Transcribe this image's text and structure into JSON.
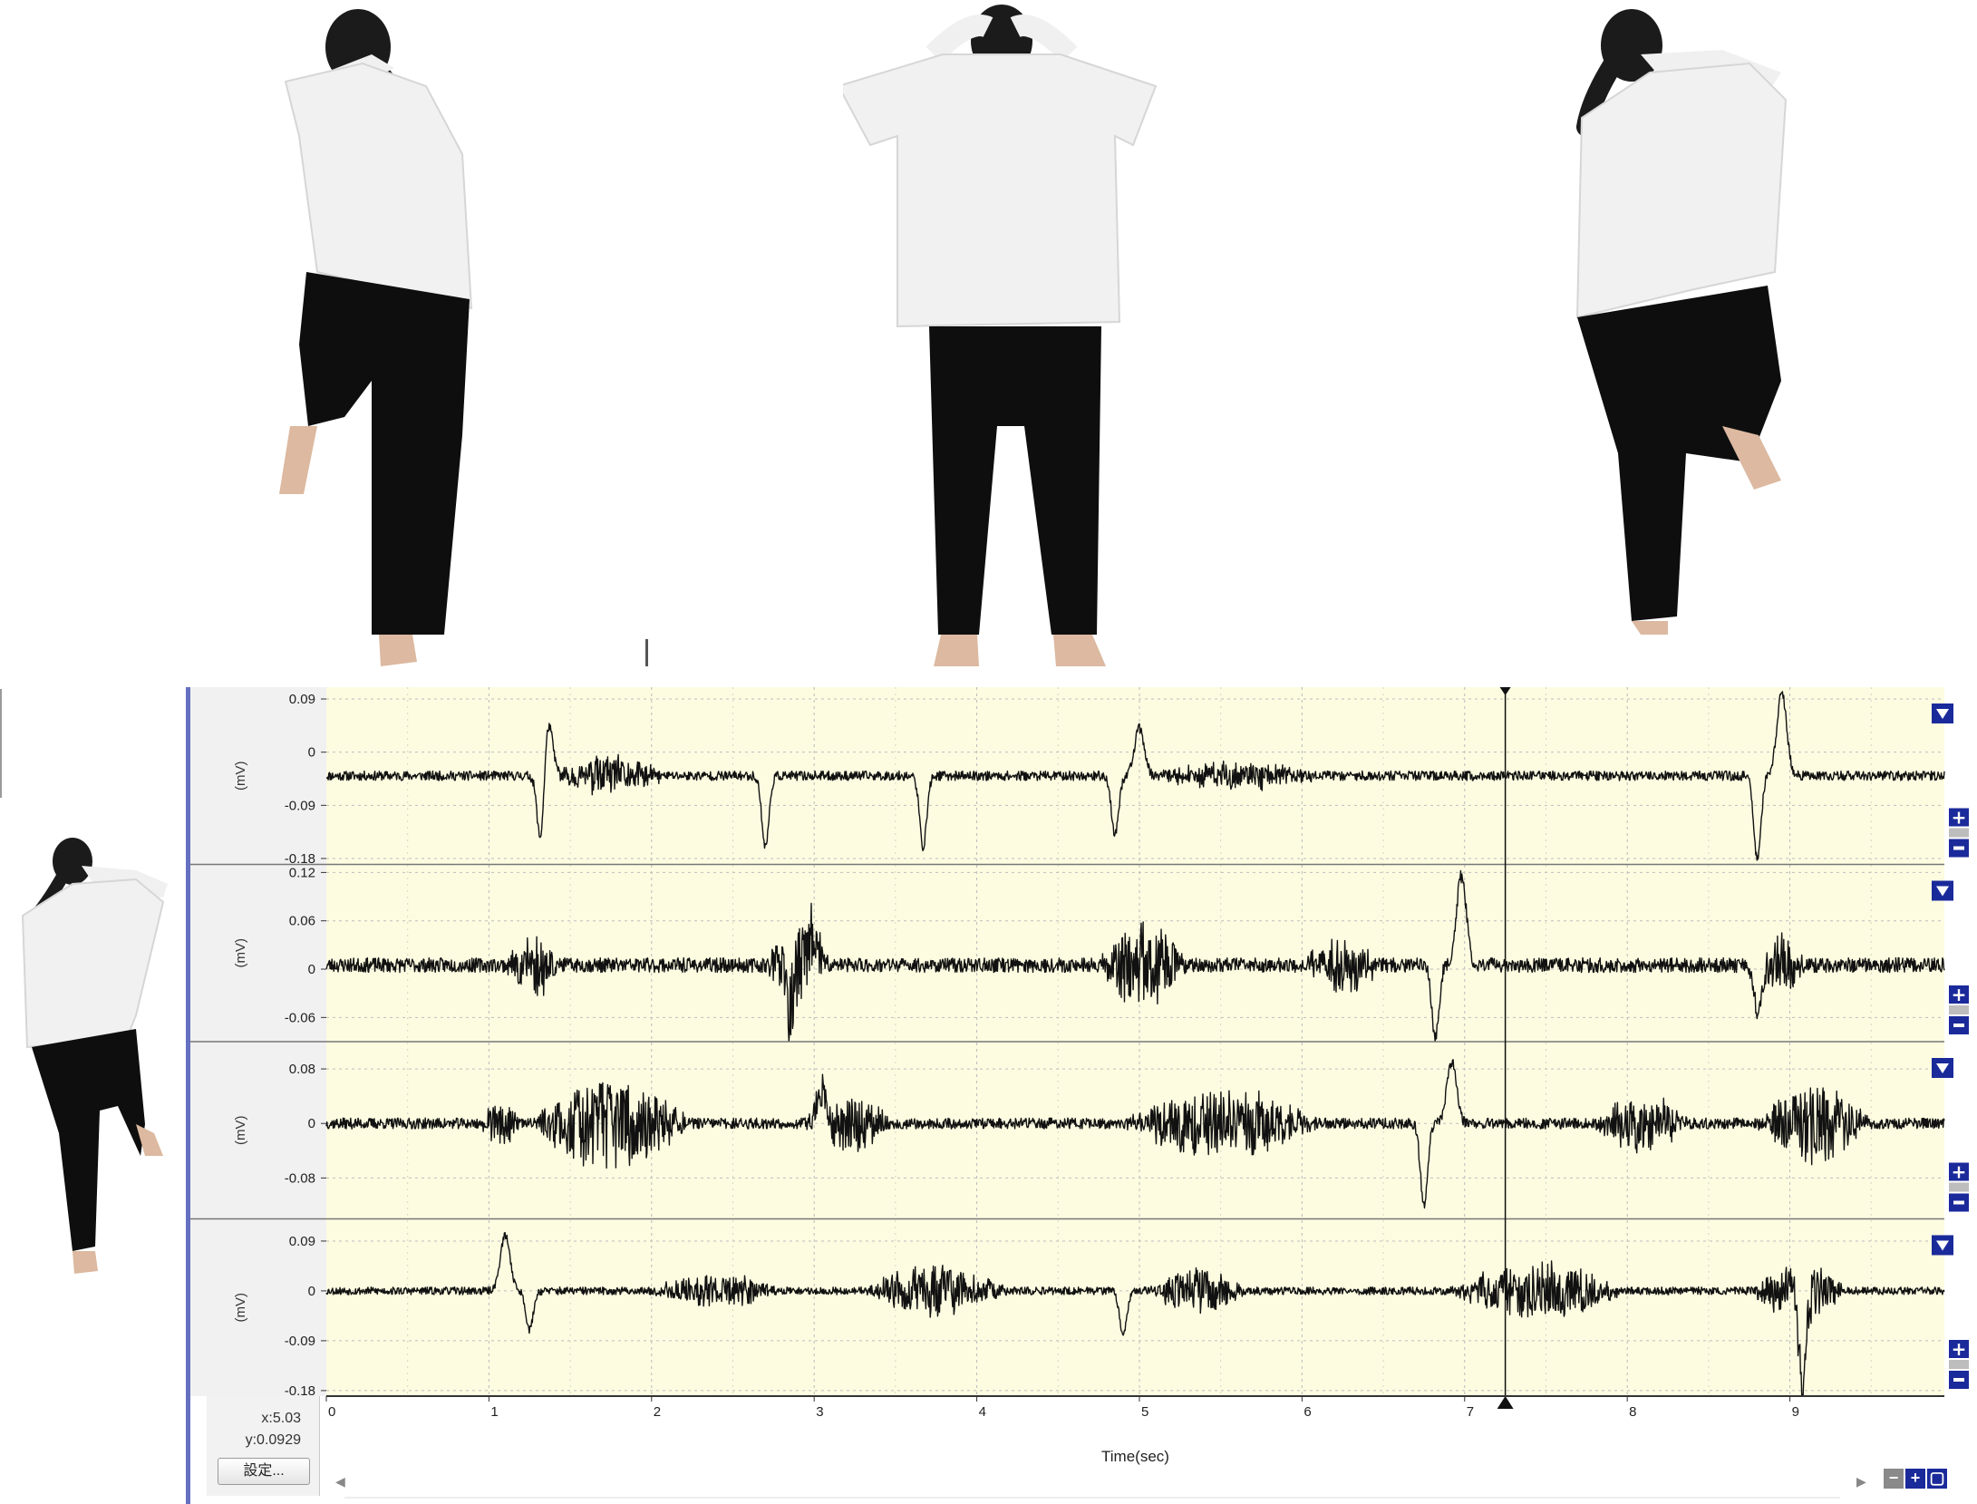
{
  "chart_data": {
    "type": "line",
    "xlabel": "Time(sec)",
    "xlim": [
      0,
      9.95
    ],
    "xticks": [
      0,
      1,
      2,
      3,
      4,
      5,
      6,
      7,
      8,
      9
    ],
    "cursor_x": 7.25,
    "line_color": "#111111",
    "plot_background": "#fdfce1",
    "grid": true,
    "channels": [
      {
        "ylabel": "(mV)",
        "yticks": [
          "0.09",
          "0",
          "-0.09",
          "-0.18"
        ],
        "tick_values": [
          0.09,
          0,
          -0.09,
          -0.18
        ],
        "ylim": [
          -0.19,
          0.11
        ],
        "baseline": -0.04,
        "noise": 0.008,
        "seed": 11,
        "events": [
          {
            "x": 1.32,
            "type": "dip",
            "amp": 0.14
          },
          {
            "x": 1.36,
            "type": "spike",
            "amp": 0.1
          },
          {
            "x": 1.4,
            "type": "burst",
            "amp": 0.03,
            "dur": 0.7
          },
          {
            "x": 2.7,
            "type": "dip",
            "amp": 0.12
          },
          {
            "x": 3.67,
            "type": "dip",
            "amp": 0.12
          },
          {
            "x": 4.85,
            "type": "dip",
            "amp": 0.1
          },
          {
            "x": 5.0,
            "type": "spike",
            "amp": 0.08
          },
          {
            "x": 5.1,
            "type": "burst",
            "amp": 0.02,
            "dur": 1.0
          },
          {
            "x": 8.8,
            "type": "dip",
            "amp": 0.14
          },
          {
            "x": 8.95,
            "type": "spike",
            "amp": 0.14
          }
        ],
        "color": "#111111"
      },
      {
        "ylabel": "(mV)",
        "yticks": [
          "0.12",
          "0.06",
          "0",
          "-0.06"
        ],
        "tick_values": [
          0.12,
          0.06,
          0,
          -0.06
        ],
        "ylim": [
          -0.09,
          0.13
        ],
        "baseline": 0.005,
        "noise": 0.009,
        "seed": 23,
        "events": [
          {
            "x": 1.1,
            "type": "burst",
            "amp": 0.035,
            "dur": 0.35
          },
          {
            "x": 2.7,
            "type": "burst",
            "amp": 0.05,
            "dur": 0.4
          },
          {
            "x": 2.85,
            "type": "dip",
            "amp": 0.06
          },
          {
            "x": 3.0,
            "type": "spike",
            "amp": 0.04
          },
          {
            "x": 4.75,
            "type": "burst",
            "amp": 0.05,
            "dur": 0.55
          },
          {
            "x": 6.0,
            "type": "burst",
            "amp": 0.03,
            "dur": 0.5
          },
          {
            "x": 6.82,
            "type": "dip",
            "amp": 0.09
          },
          {
            "x": 6.98,
            "type": "spike",
            "amp": 0.11
          },
          {
            "x": 8.75,
            "type": "burst",
            "amp": 0.035,
            "dur": 0.35
          },
          {
            "x": 8.8,
            "type": "dip",
            "amp": 0.06
          }
        ],
        "color": "#111111"
      },
      {
        "ylabel": "(mV)",
        "yticks": [
          "0.08",
          "0",
          "-0.08"
        ],
        "tick_values": [
          0.08,
          0,
          -0.08
        ],
        "ylim": [
          -0.14,
          0.12
        ],
        "baseline": 0.0,
        "noise": 0.008,
        "seed": 37,
        "events": [
          {
            "x": 0.95,
            "type": "burst",
            "amp": 0.03,
            "dur": 0.25
          },
          {
            "x": 1.25,
            "type": "burst",
            "amp": 0.065,
            "dur": 1.0
          },
          {
            "x": 2.9,
            "type": "burst",
            "amp": 0.04,
            "dur": 0.6
          },
          {
            "x": 3.05,
            "type": "spike",
            "amp": 0.05
          },
          {
            "x": 4.9,
            "type": "burst",
            "amp": 0.05,
            "dur": 1.2
          },
          {
            "x": 6.75,
            "type": "dip",
            "amp": 0.12
          },
          {
            "x": 6.92,
            "type": "spike",
            "amp": 0.09
          },
          {
            "x": 7.8,
            "type": "burst",
            "amp": 0.04,
            "dur": 0.6
          },
          {
            "x": 8.8,
            "type": "burst",
            "amp": 0.055,
            "dur": 0.7
          }
        ],
        "color": "#111111"
      },
      {
        "ylabel": "(mV)",
        "yticks": [
          "0.09",
          "0",
          "-0.09",
          "-0.18"
        ],
        "tick_values": [
          0.09,
          0,
          -0.09,
          -0.18
        ],
        "ylim": [
          -0.19,
          0.13
        ],
        "baseline": 0.0,
        "noise": 0.007,
        "seed": 53,
        "events": [
          {
            "x": 1.1,
            "type": "spike",
            "amp": 0.1
          },
          {
            "x": 1.25,
            "type": "dip",
            "amp": 0.07
          },
          {
            "x": 2.0,
            "type": "burst",
            "amp": 0.03,
            "dur": 0.8
          },
          {
            "x": 3.3,
            "type": "burst",
            "amp": 0.045,
            "dur": 0.9
          },
          {
            "x": 4.9,
            "type": "dip",
            "amp": 0.08
          },
          {
            "x": 5.05,
            "type": "burst",
            "amp": 0.04,
            "dur": 0.6
          },
          {
            "x": 6.9,
            "type": "burst",
            "amp": 0.05,
            "dur": 1.1
          },
          {
            "x": 8.75,
            "type": "burst",
            "amp": 0.05,
            "dur": 0.6
          },
          {
            "x": 9.08,
            "type": "dip",
            "amp": 0.17
          }
        ],
        "color": "#111111"
      }
    ]
  },
  "status": {
    "x_readout": "x:5.03",
    "y_readout": "y:0.0929"
  },
  "settings_button": {
    "label": "設定..."
  },
  "panel_controls": {
    "menu_icon": "triangle-down-icon",
    "plus_icon": "plus-icon",
    "minus_icon": "minus-icon",
    "accent": "#1a2a9a"
  },
  "photos": [
    {
      "pose": "left leg raised, hands behind head"
    },
    {
      "pose": "standing, hands behind head"
    },
    {
      "pose": "right leg raised, hands behind head"
    },
    {
      "pose": "left leg raised, hands behind head"
    }
  ]
}
